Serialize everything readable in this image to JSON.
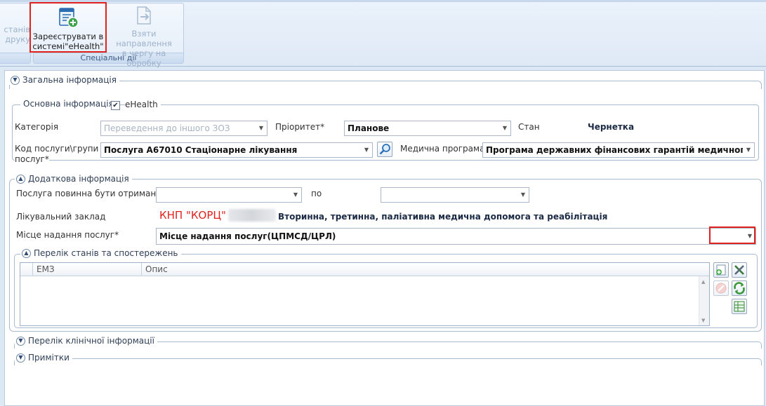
{
  "ribbon": {
    "left_group": {
      "line1": "станів",
      "line2": "друку"
    },
    "special_group": {
      "caption": "Спеціальні дії",
      "register_button": {
        "line1": "Зареєструвати в",
        "line2": "системі\"eHealth\""
      },
      "queue_button": {
        "line1": "Взяти направлення",
        "line2": "в чергу на обробку"
      }
    }
  },
  "sections": {
    "general": {
      "title": "Загальна інформація"
    },
    "main_info": {
      "title": "Основна інформація",
      "ehealth_label": "eHealth",
      "ehealth_checked": true,
      "category_label": "Категорія",
      "category_value": "Переведення до іншого ЗОЗ",
      "priority_label": "Пріоритет*",
      "priority_value": "Планове",
      "state_label": "Стан",
      "state_value": "Чернетка",
      "service_code_label_1": "Код послуги\\групи",
      "service_code_label_2": "послуг*",
      "service_code_value": "Послуга А67010 Стаціонарне лікування",
      "med_program_label": "Медична програма",
      "med_program_value": "Програма державних фінансових гарантій медичного обслуго"
    },
    "additional": {
      "title": "Додаткова інформація",
      "received_from_label": "Послуга повинна бути отримана з",
      "received_from_value": "",
      "to_label": "по",
      "to_value": "",
      "facility_label": "Лікувальний заклад",
      "facility_name": "КНП \"КОРЦ\"",
      "facility_type": "Вторинна, третинна, паліативна медична допомога та реабілітація",
      "place_label": "Місце надання послуг*",
      "place_value": "Місце надання послуг(ЦПМСД/ЦРЛ)"
    },
    "observations": {
      "title": "Перелік станів та спостережень",
      "columns": [
        "ЕМЗ",
        "Опис"
      ]
    },
    "clinical": {
      "title": "Перелік клінічної інформації"
    },
    "notes": {
      "title": "Примітки"
    }
  },
  "colors": {
    "accent_red": "#e0221f",
    "ribbon_bg": "#dfe9f6",
    "panel_border": "#b8c9de"
  }
}
